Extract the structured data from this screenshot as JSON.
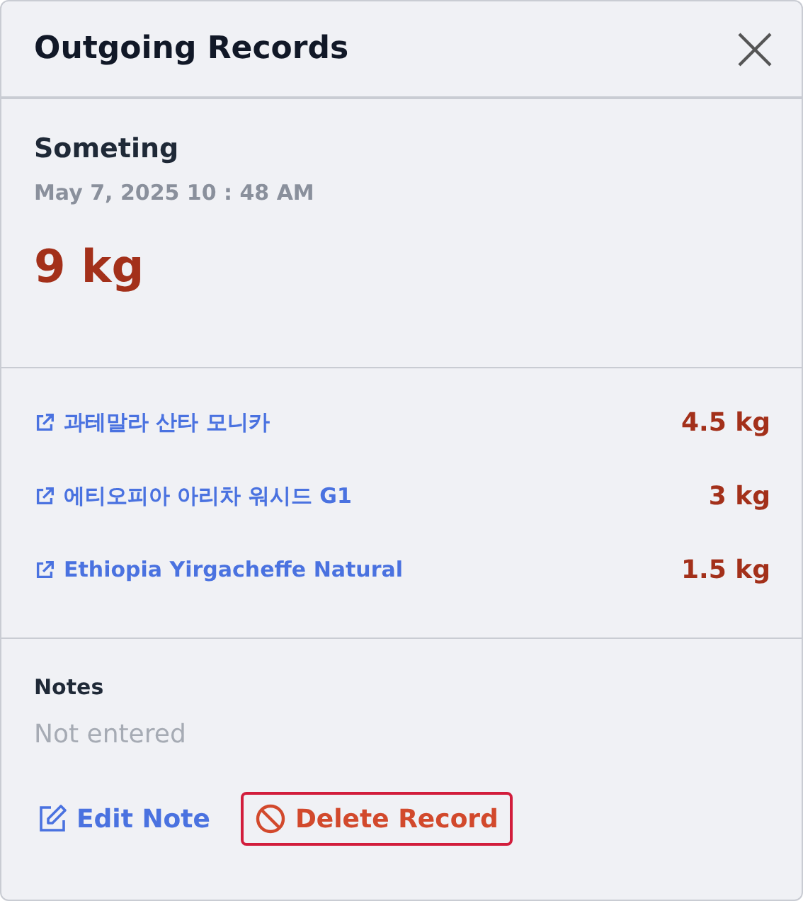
{
  "window": {
    "title": "Outgoing Records"
  },
  "record": {
    "name": "Someting",
    "datetime": "May 7, 2025 10 : 48 AM",
    "total": "9 kg"
  },
  "items": [
    {
      "name": "과테말라 산타 모니카",
      "amount": "4.5 kg"
    },
    {
      "name": "에티오피아 아리차 워시드 G1",
      "amount": "3 kg"
    },
    {
      "name": "Ethiopia Yirgacheffe Natural",
      "amount": "1.5 kg"
    }
  ],
  "notes": {
    "label": "Notes",
    "text": "Not entered"
  },
  "actions": [
    {
      "kind": "edit",
      "label": "Edit Note",
      "focused": false
    },
    {
      "kind": "delete",
      "label": "Delete Record",
      "focused": true
    }
  ]
}
